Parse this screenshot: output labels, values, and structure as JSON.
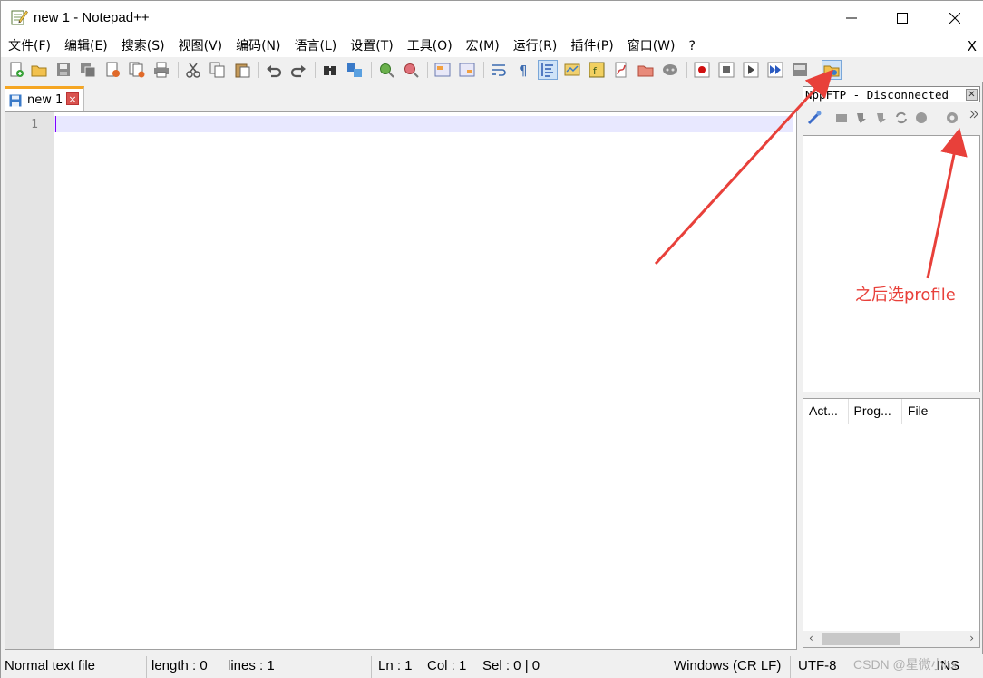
{
  "window": {
    "title": "new 1 - Notepad++"
  },
  "menu": {
    "items": [
      "文件(F)",
      "编辑(E)",
      "搜索(S)",
      "视图(V)",
      "编码(N)",
      "语言(L)",
      "设置(T)",
      "工具(O)",
      "宏(M)",
      "运行(R)",
      "插件(P)",
      "窗口(W)",
      "?"
    ],
    "close_label": "X"
  },
  "toolbar": {
    "icons": [
      "new-file-icon",
      "open-file-icon",
      "save-icon",
      "save-all-icon",
      "close-icon",
      "close-all-icon",
      "print-icon",
      "cut-icon",
      "copy-icon",
      "paste-icon",
      "undo-icon",
      "redo-icon",
      "find-icon",
      "replace-icon",
      "zoom-in-icon",
      "zoom-out-icon",
      "sync-vertical-icon",
      "sync-horizontal-icon",
      "word-wrap-icon",
      "show-all-chars-icon",
      "indent-guide-icon",
      "doc-map-icon",
      "function-list-icon",
      "folder-workspace-icon",
      "doc-list-icon",
      "monitor-icon",
      "record-macro-icon",
      "stop-macro-icon",
      "play-macro-icon",
      "run-macro-multiple-icon",
      "save-macro-icon",
      "nppftp-show-icon"
    ]
  },
  "editor": {
    "tab_label": "new 1",
    "line_number": "1"
  },
  "ftp_panel": {
    "title": "NppFTP - Disconnected",
    "queue_columns": [
      "Act...",
      "Prog...",
      "File"
    ]
  },
  "statusbar": {
    "file_type": "Normal text file",
    "length": "length : 0",
    "lines": "lines : 1",
    "ln": "Ln : 1",
    "col": "Col : 1",
    "sel": "Sel : 0 | 0",
    "eol": "Windows (CR LF)",
    "encoding": "UTF-8",
    "mode": "INS"
  },
  "annotation": {
    "text": "之后选profile",
    "color": "#e8403a"
  },
  "watermark": "CSDN @星微小hx"
}
